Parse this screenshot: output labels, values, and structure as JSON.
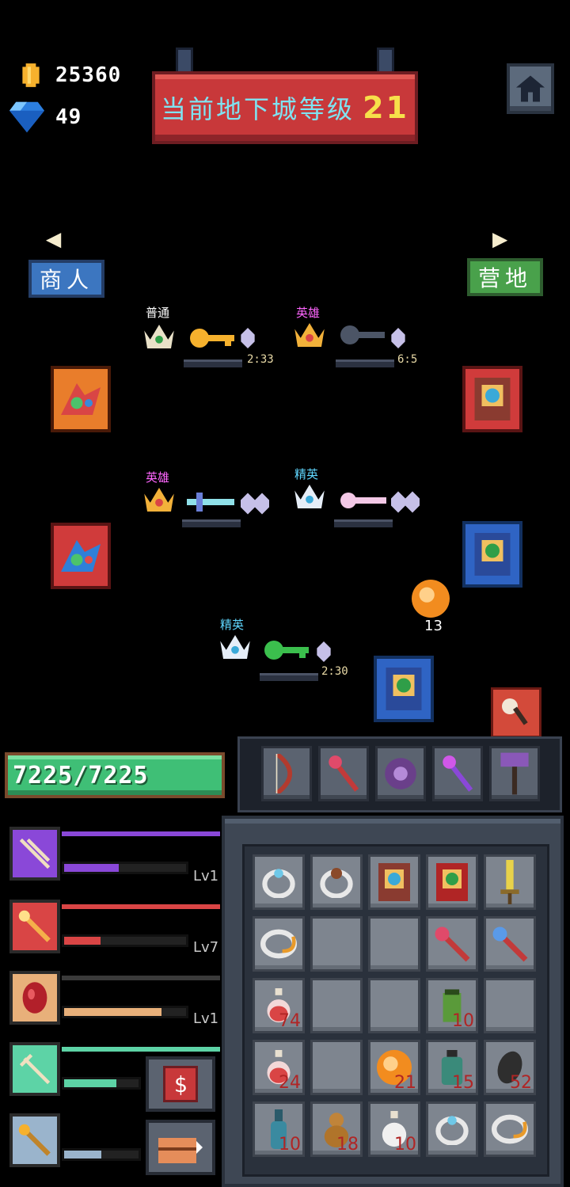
{
  "currency": {
    "gold": "25360",
    "gems": "49"
  },
  "header": {
    "title": "当前地下城等级",
    "level": "21"
  },
  "nav": {
    "merchant": "商人",
    "camp": "营地"
  },
  "map": {
    "tier_labels": {
      "normal": "普通",
      "hero": "英雄",
      "elite": "精英"
    },
    "timers": [
      "2:33",
      "6:5",
      "2:30"
    ],
    "orb_count": "13"
  },
  "hp": {
    "text": "7225/7225"
  },
  "skills": [
    {
      "level": "Lv1",
      "fill": 0.45,
      "color": "#8a48d8"
    },
    {
      "level": "Lv7",
      "fill": 0.3,
      "color": "#d94545"
    },
    {
      "level": "Lv1",
      "fill": 0.8,
      "color": "#e8b07a"
    },
    {
      "level": "",
      "fill": 0.7,
      "color": "#5dd3a6"
    },
    {
      "level": "",
      "fill": 0.5,
      "color": "#9ab4cc"
    }
  ],
  "inventory": {
    "counts": [
      "",
      "",
      "",
      "",
      "",
      "",
      "",
      "",
      "",
      "",
      "74",
      "",
      "",
      "10",
      "",
      "24",
      "",
      "21",
      "15",
      "52",
      "10",
      "18",
      "10",
      "",
      ""
    ]
  },
  "buttons": {
    "sell": "$"
  }
}
